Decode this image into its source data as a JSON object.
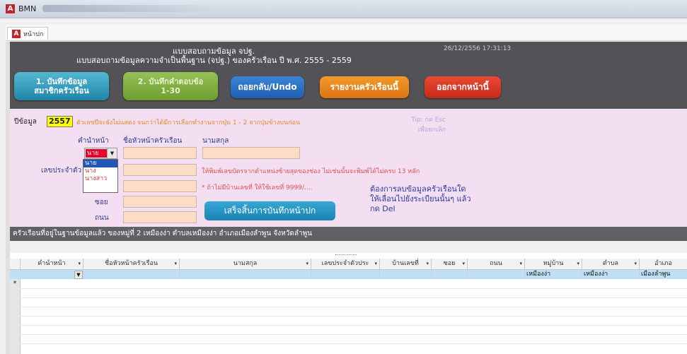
{
  "window": {
    "app_icon_letter": "A",
    "title": "BMN"
  },
  "tab": {
    "label": "หน้าปก"
  },
  "header": {
    "title1": "แบบสอบถามข้อมูล จปฐ.",
    "title2": "แบบสอบถามข้อมูลความจำเป็นพื้นฐาน (จปฐ.) ของครัวเรือน ปี พ.ศ. 2555 - 2559",
    "datetime": "26/12/2556 17:31:13",
    "buttons": {
      "record_members": "1. บันทึกข้อมูล\nสมาชิกครัวเรือน",
      "record_answers": "2. บันทึกคำตอบข้อ\n1-30",
      "undo": "ถอยกลับ/Undo",
      "report": "รายงานครัวเรือนนี้",
      "exit": "ออกจากหน้านี้"
    }
  },
  "form": {
    "year_label": "ปีข้อมูล",
    "year_value": "2557",
    "year_note": "ตัวเลขปีจะยังไม่แสดง จนกว่าได้มีการเลือกทำงานจากปุ่ม 1 - 2 จากปุ่มข้างบนก่อน",
    "tip": "Tip: กด Esc\nเพื่อยกเลิก",
    "prefix_label": "คำนำหน้า",
    "head_name_label": "ชื่อหัวหน้าครัวเรือน",
    "surname_label": "นามสกุล",
    "prefix_value": "นาย",
    "prefix_options": [
      "นาย",
      "นาง",
      "นางสาว"
    ],
    "id_label": "เลขประจำตัว",
    "id_note": "ให้พิมพ์เลขบัตรจากตำแหน่งซ้ายสุดของช่อง ไม่เช่นนั้นจะพิมพ์ได้ไม่ครบ 13 หลัก",
    "house_note": "* ถ้าไม่มีบ้านเลขที่ ให้ใช้เลขที่ 9999/....",
    "soi_label": "ซอย",
    "road_label": "ถนน",
    "save_button": "เสร็จสิ้นการบันทึกหน้าปก",
    "delete_note": "ต้องการลบข้อมูลครัวเรือนใด\nให้เลื่อนไปยังระเบียนนั้นๆ แล้ว\nกด Del"
  },
  "status": "ครัวเรือนที่อยู่ในฐานข้อมูลแล้ว ของหมู่ที่ 2 เหมืองง่า ตำบลเหมืองง่า อำเภอเมืองลำพูน จังหวัดลำพูน",
  "table": {
    "columns": [
      "คำนำหน้า",
      "ชื่อหัวหน้าครัวเรือน",
      "นามสกุล",
      "เลขประจำตัวประ",
      "บ้านเลขที่",
      "ซอย",
      "ถนน",
      "หมู่บ้าน",
      "ตำบล",
      "อำเภอ"
    ],
    "row": {
      "village": "เหมืองง่า",
      "subdistrict": "เหมืองง่า",
      "district": "เมืองลำพูน"
    },
    "edit_marker": "✎",
    "new_marker": "*"
  }
}
